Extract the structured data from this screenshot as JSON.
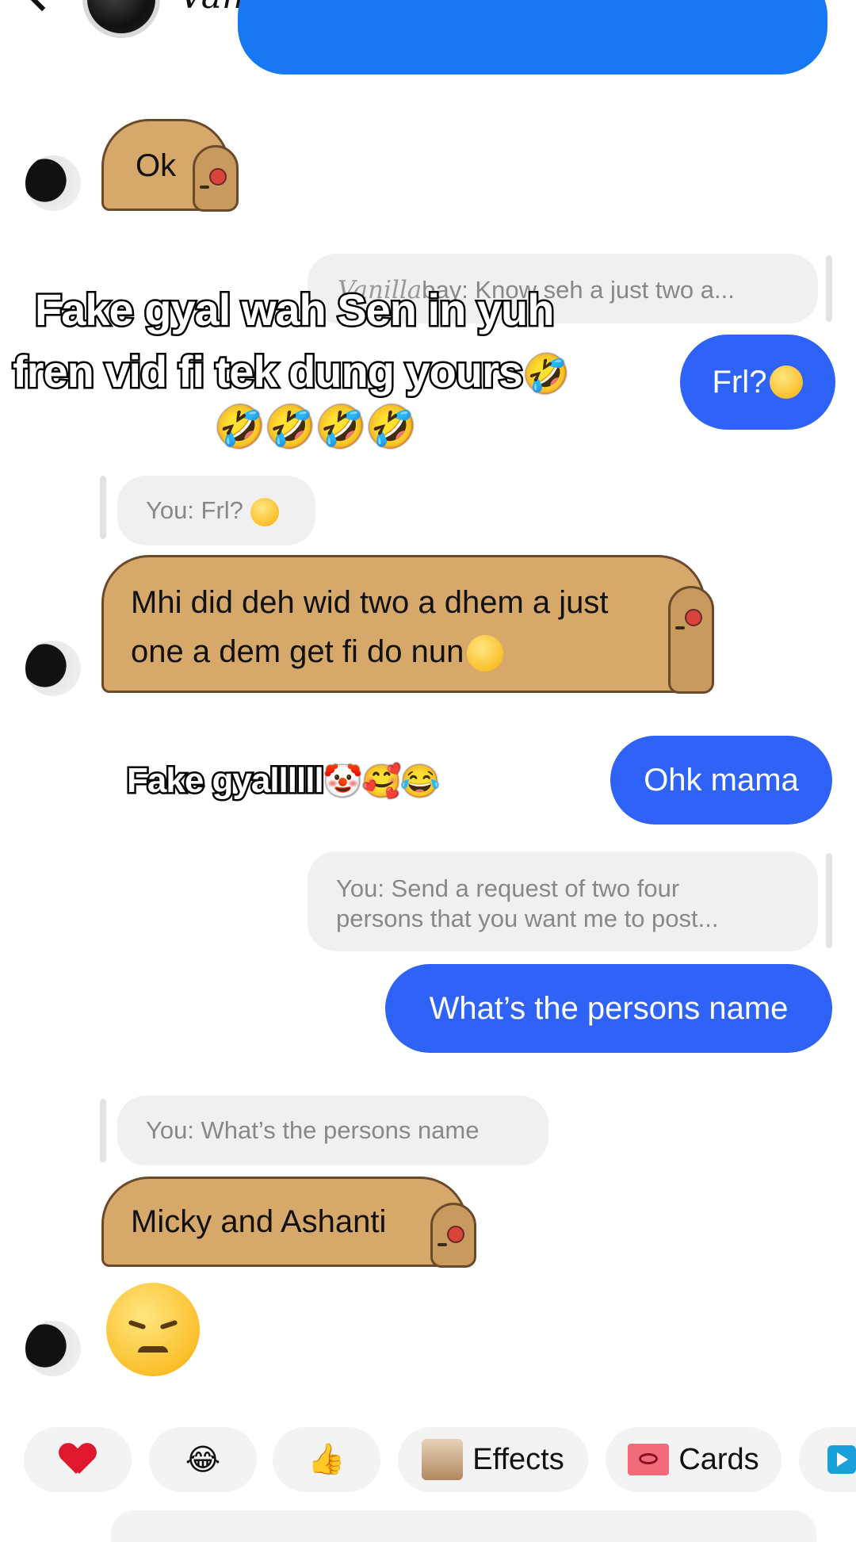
{
  "header": {
    "name": "Vanillababy"
  },
  "messages": {
    "ok": "Ok",
    "reply_vanilla_prefix": "Vanilla",
    "reply_vanilla_rest": "bay: Know seh a just two a...",
    "frl": "Frl?",
    "reply_frl": "You: Frl?",
    "mhi_line1": "Mhi did deh wid two a dhem a just",
    "mhi_line2": "one a dem get fi do nun",
    "ohk": "Ohk mama",
    "reply_request_line1": "You: Send a request of two four",
    "reply_request_line2": "persons that you want me to post...",
    "whats_name": "What’s the persons name",
    "reply_whats_name": "You: What’s the persons name",
    "micky": "Micky and Ashanti"
  },
  "captions": {
    "line1": "Fake gyal wah Sen in yuh",
    "line2": "fren vid fi tek dung yours",
    "line3_emojis": "🤣🤣🤣🤣",
    "line2_emoji": "🤣",
    "fake_gyal": "Fake gyallllll",
    "fake_gyal_emojis": "🤡🥰😂"
  },
  "quick_replies": {
    "laugh": "😂",
    "thumbs": "👍",
    "effects": "Effects",
    "cards": "Cards"
  },
  "colors": {
    "outgoing": "#2f63f7",
    "capybara": "#d6a86a",
    "reply_bg": "#f0f0f0"
  },
  "icons": {
    "back": "chevron-left-icon",
    "heart": "heart-icon",
    "cards": "gift-ribbon-icon",
    "play": "play-icon"
  }
}
